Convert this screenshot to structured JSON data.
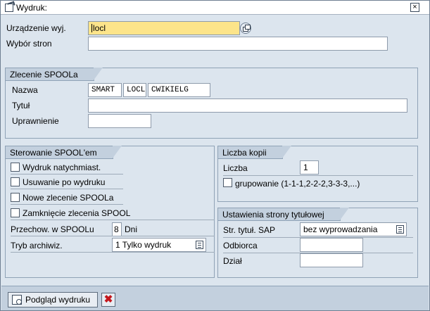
{
  "window": {
    "title": "Wydruk:",
    "close_glyph": "×"
  },
  "top": {
    "device_label": "Urządzenie wyj.",
    "device_value": "locl",
    "pages_label": "Wybór stron",
    "pages_value": ""
  },
  "spool_request": {
    "title": "Zlecenie SPOOLa",
    "name_label": "Nazwa",
    "name_parts": [
      "SMART",
      "LOCL",
      "CWIKIELG"
    ],
    "title_label": "Tytuł",
    "title_value": "",
    "auth_label": "Uprawnienie",
    "auth_value": ""
  },
  "spool_control": {
    "title": "Sterowanie SPOOL'em",
    "checkboxes": [
      {
        "label": "Wydruk natychmiast.",
        "checked": false
      },
      {
        "label": "Usuwanie po wydruku",
        "checked": false
      },
      {
        "label": "Nowe zlecenie SPOOLa",
        "checked": false
      },
      {
        "label": "Zamknięcie zlecenia SPOOL",
        "checked": false
      }
    ],
    "retention_label": "Przechow. w SPOOLu",
    "retention_value": "8",
    "retention_unit": "Dni",
    "archive_label": "Tryb archiwiz.",
    "archive_value": "1 Tylko wydruk"
  },
  "copies": {
    "title": "Liczba kopii",
    "count_label": "Liczba",
    "count_value": "1",
    "collate_label": "grupowanie (1-1-1,2-2-2,3-3-3,...)",
    "collate_checked": false
  },
  "cover_page": {
    "title": "Ustawienia strony tytułowej",
    "sap_cover_label": "Str. tytuł. SAP",
    "sap_cover_value": "bez wyprowadzania",
    "recipient_label": "Odbiorca",
    "recipient_value": "",
    "department_label": "Dział",
    "department_value": ""
  },
  "footer": {
    "preview_label": "Podgląd wydruku",
    "cancel_glyph": "✖"
  }
}
